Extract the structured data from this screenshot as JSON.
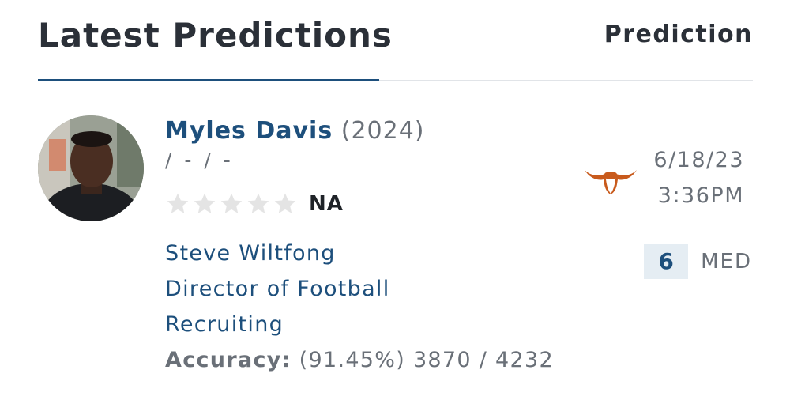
{
  "header": {
    "title": "Latest Predictions",
    "column_label": "Prediction"
  },
  "prediction": {
    "player": {
      "name": "Myles Davis",
      "year": "(2024)",
      "meta": "/ - / -",
      "stars_filled": 0,
      "stars_total": 5,
      "rating": "NA"
    },
    "expert": {
      "name": "Steve Wiltfong",
      "title_line1": "Director of Football",
      "title_line2": "Recruiting",
      "accuracy_label": "Accuracy:",
      "accuracy_value": "(91.45%) 3870 / 4232"
    },
    "team": {
      "logo_icon": "longhorn-icon",
      "color": "#c85a1c"
    },
    "date": "6/18/23",
    "time": "3:36PM",
    "confidence": {
      "value": "6",
      "level": "MED"
    }
  },
  "colors": {
    "accent": "#1d4f7c",
    "text_dark": "#2b3038",
    "text_muted": "#6a7078",
    "star_empty": "#e4e4e4"
  }
}
